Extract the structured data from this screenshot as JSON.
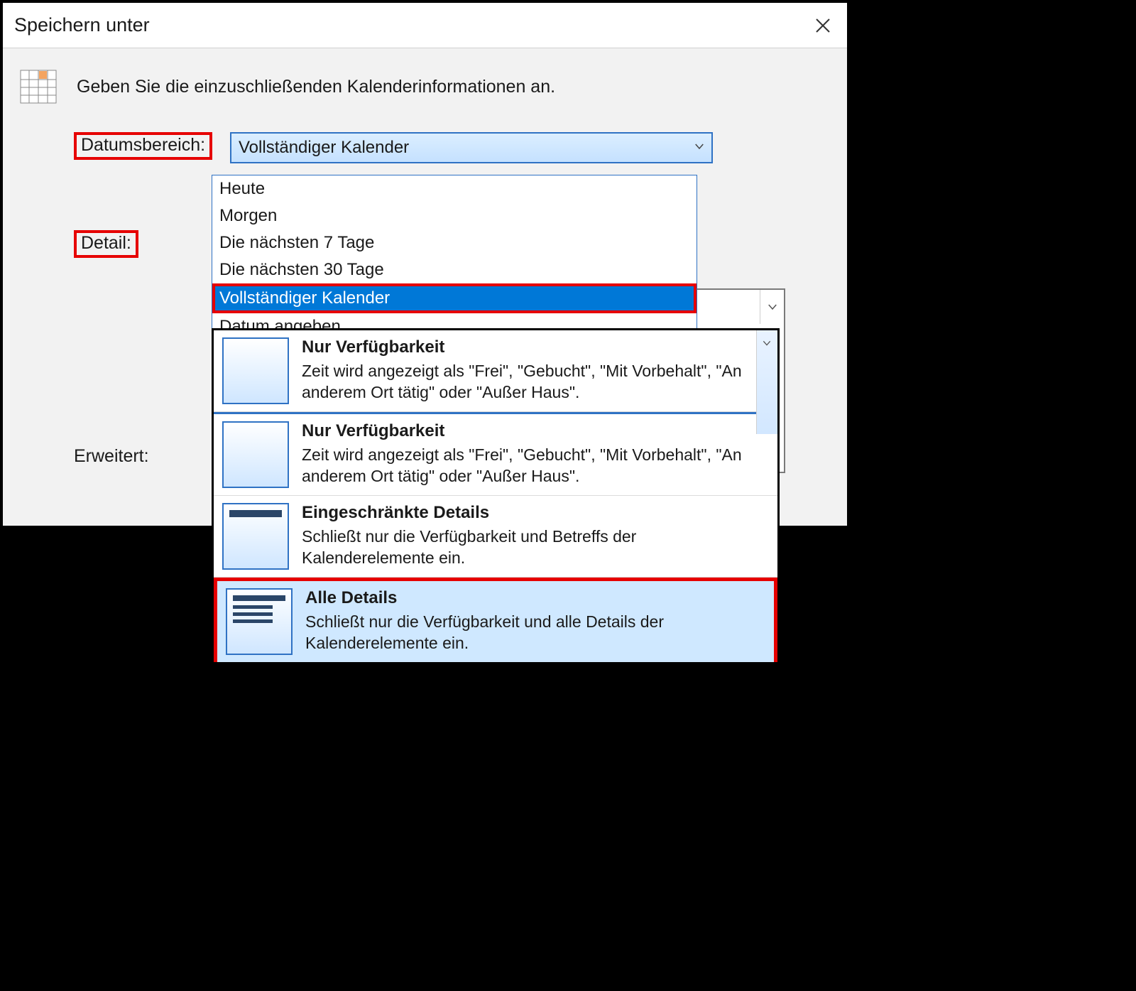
{
  "dialog": {
    "title": "Speichern unter"
  },
  "instruction": "Geben Sie die einzuschließenden Kalenderinformationen an.",
  "labels": {
    "date_range": "Datumsbereich:",
    "detail": "Detail:",
    "advanced": "Erweitert:"
  },
  "date_range": {
    "selected": "Vollständiger Kalender",
    "options": [
      "Heute",
      "Morgen",
      "Die nächsten 7 Tage",
      "Die nächsten 30 Tage",
      "Vollständiger Kalender",
      "Datum angeben..."
    ],
    "highlighted_index": 4
  },
  "detail": {
    "obscured_tail": "Haus\".",
    "options": [
      {
        "title": "Nur Verfügbarkeit",
        "description": "Zeit wird angezeigt als \"Frei\", \"Gebucht\", \"Mit Vorbehalt\", \"An anderem Ort tätig\" oder \"Außer Haus\".",
        "icon": "stripe"
      },
      {
        "title": "Nur Verfügbarkeit",
        "description": "Zeit wird angezeigt als \"Frei\", \"Gebucht\", \"Mit Vorbehalt\", \"An anderem Ort tätig\" oder \"Außer Haus\".",
        "icon": "stripe"
      },
      {
        "title": "Eingeschränkte Details",
        "description": "Schließt nur die Verfügbarkeit und Betreffs der Kalenderelemente ein.",
        "icon": "limited"
      },
      {
        "title": "Alle Details",
        "description": "Schließt nur die Verfügbarkeit und alle Details der Kalenderelemente ein.",
        "icon": "all"
      }
    ],
    "highlighted_index": 3
  }
}
